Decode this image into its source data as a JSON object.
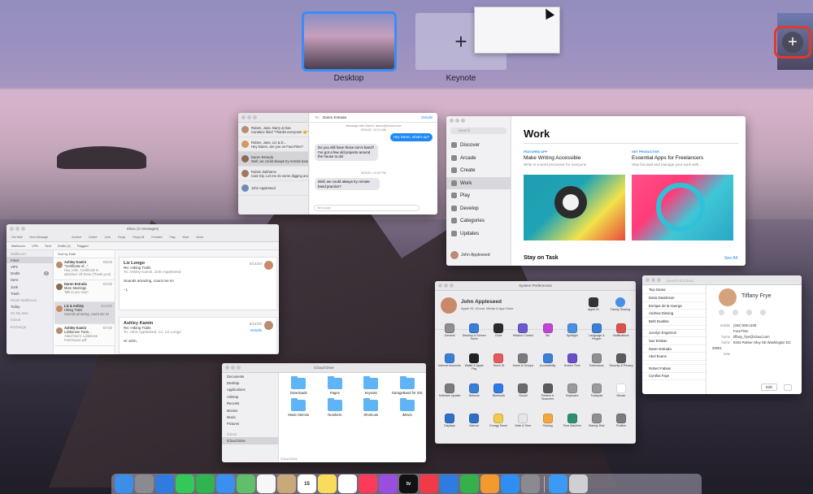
{
  "spaces": {
    "desktop_label": "Desktop",
    "keynote_label": "Keynote",
    "new_space_symbol": "+",
    "add_space_symbol": "+"
  },
  "messages": {
    "header_to": "To:",
    "header_name": "Daren Estrada",
    "header_action": "Details",
    "conversations": [
      {
        "name": "Ruben, Jane, Barry & Dan",
        "time": "9/23/20",
        "preview": "Candace liked \"Thanks everyone! 😊\""
      },
      {
        "name": "Ruben, Jane, Liz & D...",
        "time": "9/23/20",
        "preview": "Hey Daren, are you on FaceTime?"
      },
      {
        "name": "Daren Estrada",
        "time": "9/23/20",
        "preview": "Well, we could always try remote band practice?"
      },
      {
        "name": "Ruben Zakharov",
        "time": "9/19/20",
        "preview": "Cute trip. Let me do some digging and I'll get back to you"
      },
      {
        "name": "John Appleseed",
        "time": "9/18/20",
        "preview": ""
      }
    ],
    "thread_meta_1": "Message with Daren, daren@icloud.com",
    "thread_meta_2": "5/24/20, 10:21 AM",
    "bubble_blue": "Hey Daren, what's up?",
    "bubble_gray_1": "Do you still have those tom's band? I've got a few old projects around the house to do!",
    "thread_meta_3": "5/25/20, 10:42 PM",
    "bubble_gray_2": "Well, we could always try remote band practice?",
    "input_placeholder": "iMessage"
  },
  "appstore": {
    "search_placeholder": "Search",
    "nav": [
      "Discover",
      "Arcade",
      "Create",
      "Work",
      "Play",
      "Develop",
      "Categories",
      "Updates"
    ],
    "user": "John Appleseed",
    "title": "Work",
    "card1_tag": "FEATURED APP",
    "card1_title": "Make Writing Accessible",
    "card1_sub": "Write in a word processor for everyone",
    "card2_tag": "GET PRODUCTIVE",
    "card2_title": "Essential Apps for Freelancers",
    "card2_sub": "Stay focused and manage your work with...",
    "section_title": "Stay on Task",
    "see_all": "See All"
  },
  "mail": {
    "window_title": "Inbox (3 messages)",
    "toolbar": [
      "Get Mail",
      "New Message",
      "Archive",
      "Delete",
      "Junk",
      "Reply",
      "Reply All",
      "Forward",
      "Flag",
      "Mute",
      "Move"
    ],
    "favorites": [
      "Mailboxes",
      "VIPs",
      "Sent",
      "Drafts (3)",
      "Flagged"
    ],
    "mailboxes": [
      "Mailboxes",
      "Inbox",
      "VIPs",
      "Drafts",
      "Sent",
      "Junk",
      "Trash",
      "Smart Mailboxes",
      "Today",
      "On My Mac",
      "iCloud",
      "Exchange"
    ],
    "drafts_count": "3",
    "sort_label": "Sort by Date",
    "messages": [
      {
        "from": "Ashley Kamin",
        "date": "6/3/20",
        "subject": "\"Certificate of...\"",
        "preview": "Hey John, Certificate is attached. All Done (Thank you!)"
      },
      {
        "from": "Daren Estrada",
        "date": "6/1/20",
        "subject": "More Meetings",
        "preview": "Talk to you soon"
      },
      {
        "from": "Liz & Ashley",
        "date": "5/14/20",
        "subject": "Hiking Trails",
        "preview": "Sounds amazing, count me in!"
      },
      {
        "from": "Ashley Kamin",
        "date": "5/7/20",
        "subject": "Lobbeneer Farm...",
        "preview": "Attachment: Lobbenee Farmhouse.pdf"
      }
    ],
    "reading1_from": "Liz Longo",
    "reading1_date": "5/14/20",
    "reading1_subject": "Re: Hiking Trails",
    "reading1_to": "To: Ashley Kamin, John Appleseed",
    "reading1_body": "Sounds amazing, count me in!",
    "reading1_sign": "- L",
    "reading2_from": "Ashley Kamin",
    "reading2_date": "5/14/20",
    "reading2_subject": "Re: Hiking Trails",
    "reading2_to": "To: John Appleseed, Cc: Liz Longo",
    "reading2_action": "Details",
    "reading2_body": "Hi John,"
  },
  "sysprefs": {
    "window_title": "System Preferences",
    "user_name": "John Appleseed",
    "user_sub": "Apple ID, iCloud, Media & App Store",
    "apple_id": "Apple ID",
    "family": "Family Sharing",
    "items": [
      {
        "label": "General",
        "color": "#8e8e93"
      },
      {
        "label": "Desktop & Screen Saver",
        "color": "#3a7ed6"
      },
      {
        "label": "Dock",
        "color": "#2b2b2b"
      },
      {
        "label": "Mission Control",
        "color": "#6a5acd"
      },
      {
        "label": "Siri",
        "color": "#c244d6"
      },
      {
        "label": "Spotlight",
        "color": "#4a90e2"
      },
      {
        "label": "Language & Region",
        "color": "#3a7ed6"
      },
      {
        "label": "Notifications",
        "color": "#d9534f"
      },
      {
        "label": "Internet Accounts",
        "color": "#3a7ed6"
      },
      {
        "label": "Wallet & Apple Pay",
        "color": "#222222"
      },
      {
        "label": "Touch ID",
        "color": "#e55b5b"
      },
      {
        "label": "Users & Groups",
        "color": "#7a7a80"
      },
      {
        "label": "Accessibility",
        "color": "#3a7ed6"
      },
      {
        "label": "Screen Time",
        "color": "#6a4fc8"
      },
      {
        "label": "Extensions",
        "color": "#8e8e93"
      },
      {
        "label": "Security & Privacy",
        "color": "#5a5a60"
      },
      {
        "label": "Software Update",
        "color": "#7a7a80"
      },
      {
        "label": "Network",
        "color": "#3a7ed6"
      },
      {
        "label": "Bluetooth",
        "color": "#2f7ae5"
      },
      {
        "label": "Sound",
        "color": "#6a6a70"
      },
      {
        "label": "Printers & Scanners",
        "color": "#5a5a60"
      },
      {
        "label": "Keyboard",
        "color": "#9a9aa0"
      },
      {
        "label": "Trackpad",
        "color": "#9a9aa0"
      },
      {
        "label": "Mouse",
        "color": "#ffffff"
      },
      {
        "label": "Displays",
        "color": "#2f6fc8"
      },
      {
        "label": "Sidecar",
        "color": "#2f6fc8"
      },
      {
        "label": "Energy Saver",
        "color": "#f2c94c"
      },
      {
        "label": "Date & Time",
        "color": "#e5e5ea"
      },
      {
        "label": "Sharing",
        "color": "#f2a93b"
      },
      {
        "label": "Time Machine",
        "color": "#2d8f6f"
      },
      {
        "label": "Startup Disk",
        "color": "#8e8e93"
      },
      {
        "label": "Profiles",
        "color": "#7a7a80"
      }
    ]
  },
  "contacts": {
    "search_placeholder": "Search All iCloud",
    "names": [
      "Tejo Dama",
      "Daria Davidsson",
      "Enrique de la Huerga",
      "Andrew Dinsing",
      "Beth Duahite",
      "",
      "Jocelyn Engstrom",
      "Sue Erokan",
      "Daren Estrada",
      "Abel Evans",
      "",
      "Robert Fabian",
      "Cynthia Faye"
    ],
    "detail_name": "Tiffany Frye",
    "actions": [
      "message",
      "call",
      "video",
      "mail"
    ],
    "fields": [
      {
        "label": "mobile",
        "value": "(262) 555-1109"
      },
      {
        "label": "",
        "value": "FaceTime"
      },
      {
        "label": "home",
        "value": "tiffany_frye@icloud.com"
      },
      {
        "label": "home",
        "value": "9344 Palmer Alley SE Washington DC 20001"
      },
      {
        "label": "note",
        "value": ""
      }
    ],
    "edit_label": "Edit"
  },
  "finder": {
    "window_title": "iCloud Drive",
    "sidebar": [
      "Documents",
      "Desktop",
      "Applications",
      "AirDrop",
      "Recents",
      "Movies",
      "Music",
      "Pictures"
    ],
    "icloud_section": "iCloud",
    "icloud_drive": "iCloud Drive",
    "folders": [
      "Downloads",
      "Pages",
      "Keynote",
      "GarageBand for iOS",
      "Music Memos",
      "Numbers",
      "Shortcuts",
      "iMovie"
    ],
    "status": "iCloud Drive"
  },
  "dock": {
    "apps": [
      {
        "name": "Finder",
        "color": "#3c8ee8"
      },
      {
        "name": "Launchpad",
        "color": "#8a8a90"
      },
      {
        "name": "Safari",
        "color": "#2f7be0"
      },
      {
        "name": "Messages",
        "color": "#34c759"
      },
      {
        "name": "FaceTime",
        "color": "#2fb450"
      },
      {
        "name": "Mail",
        "color": "#3b8ff0"
      },
      {
        "name": "Maps",
        "color": "#5fbf6a"
      },
      {
        "name": "Photos",
        "color": "#f7f7f7"
      },
      {
        "name": "Contacts",
        "color": "#c9a97a"
      },
      {
        "name": "Calendar",
        "color": "#ffffff"
      },
      {
        "name": "Notes",
        "color": "#f9dc5c"
      },
      {
        "name": "Reminders",
        "color": "#ffffff"
      },
      {
        "name": "Music",
        "color": "#fa3c5a"
      },
      {
        "name": "Podcasts",
        "color": "#9b4de0"
      },
      {
        "name": "Apple TV",
        "color": "#111111"
      },
      {
        "name": "News",
        "color": "#f03a48"
      },
      {
        "name": "Keynote",
        "color": "#2f7be0"
      },
      {
        "name": "Numbers",
        "color": "#35b04a"
      },
      {
        "name": "Pages",
        "color": "#f39a2e"
      },
      {
        "name": "App Store",
        "color": "#2f8ef2"
      },
      {
        "name": "System Preferences",
        "color": "#8a8a90"
      },
      {
        "name": "Downloads",
        "color": "#3b9af5"
      },
      {
        "name": "Trash",
        "color": "#cfcfd4"
      }
    ],
    "calendar_day": "15",
    "tv_label": "tv"
  }
}
